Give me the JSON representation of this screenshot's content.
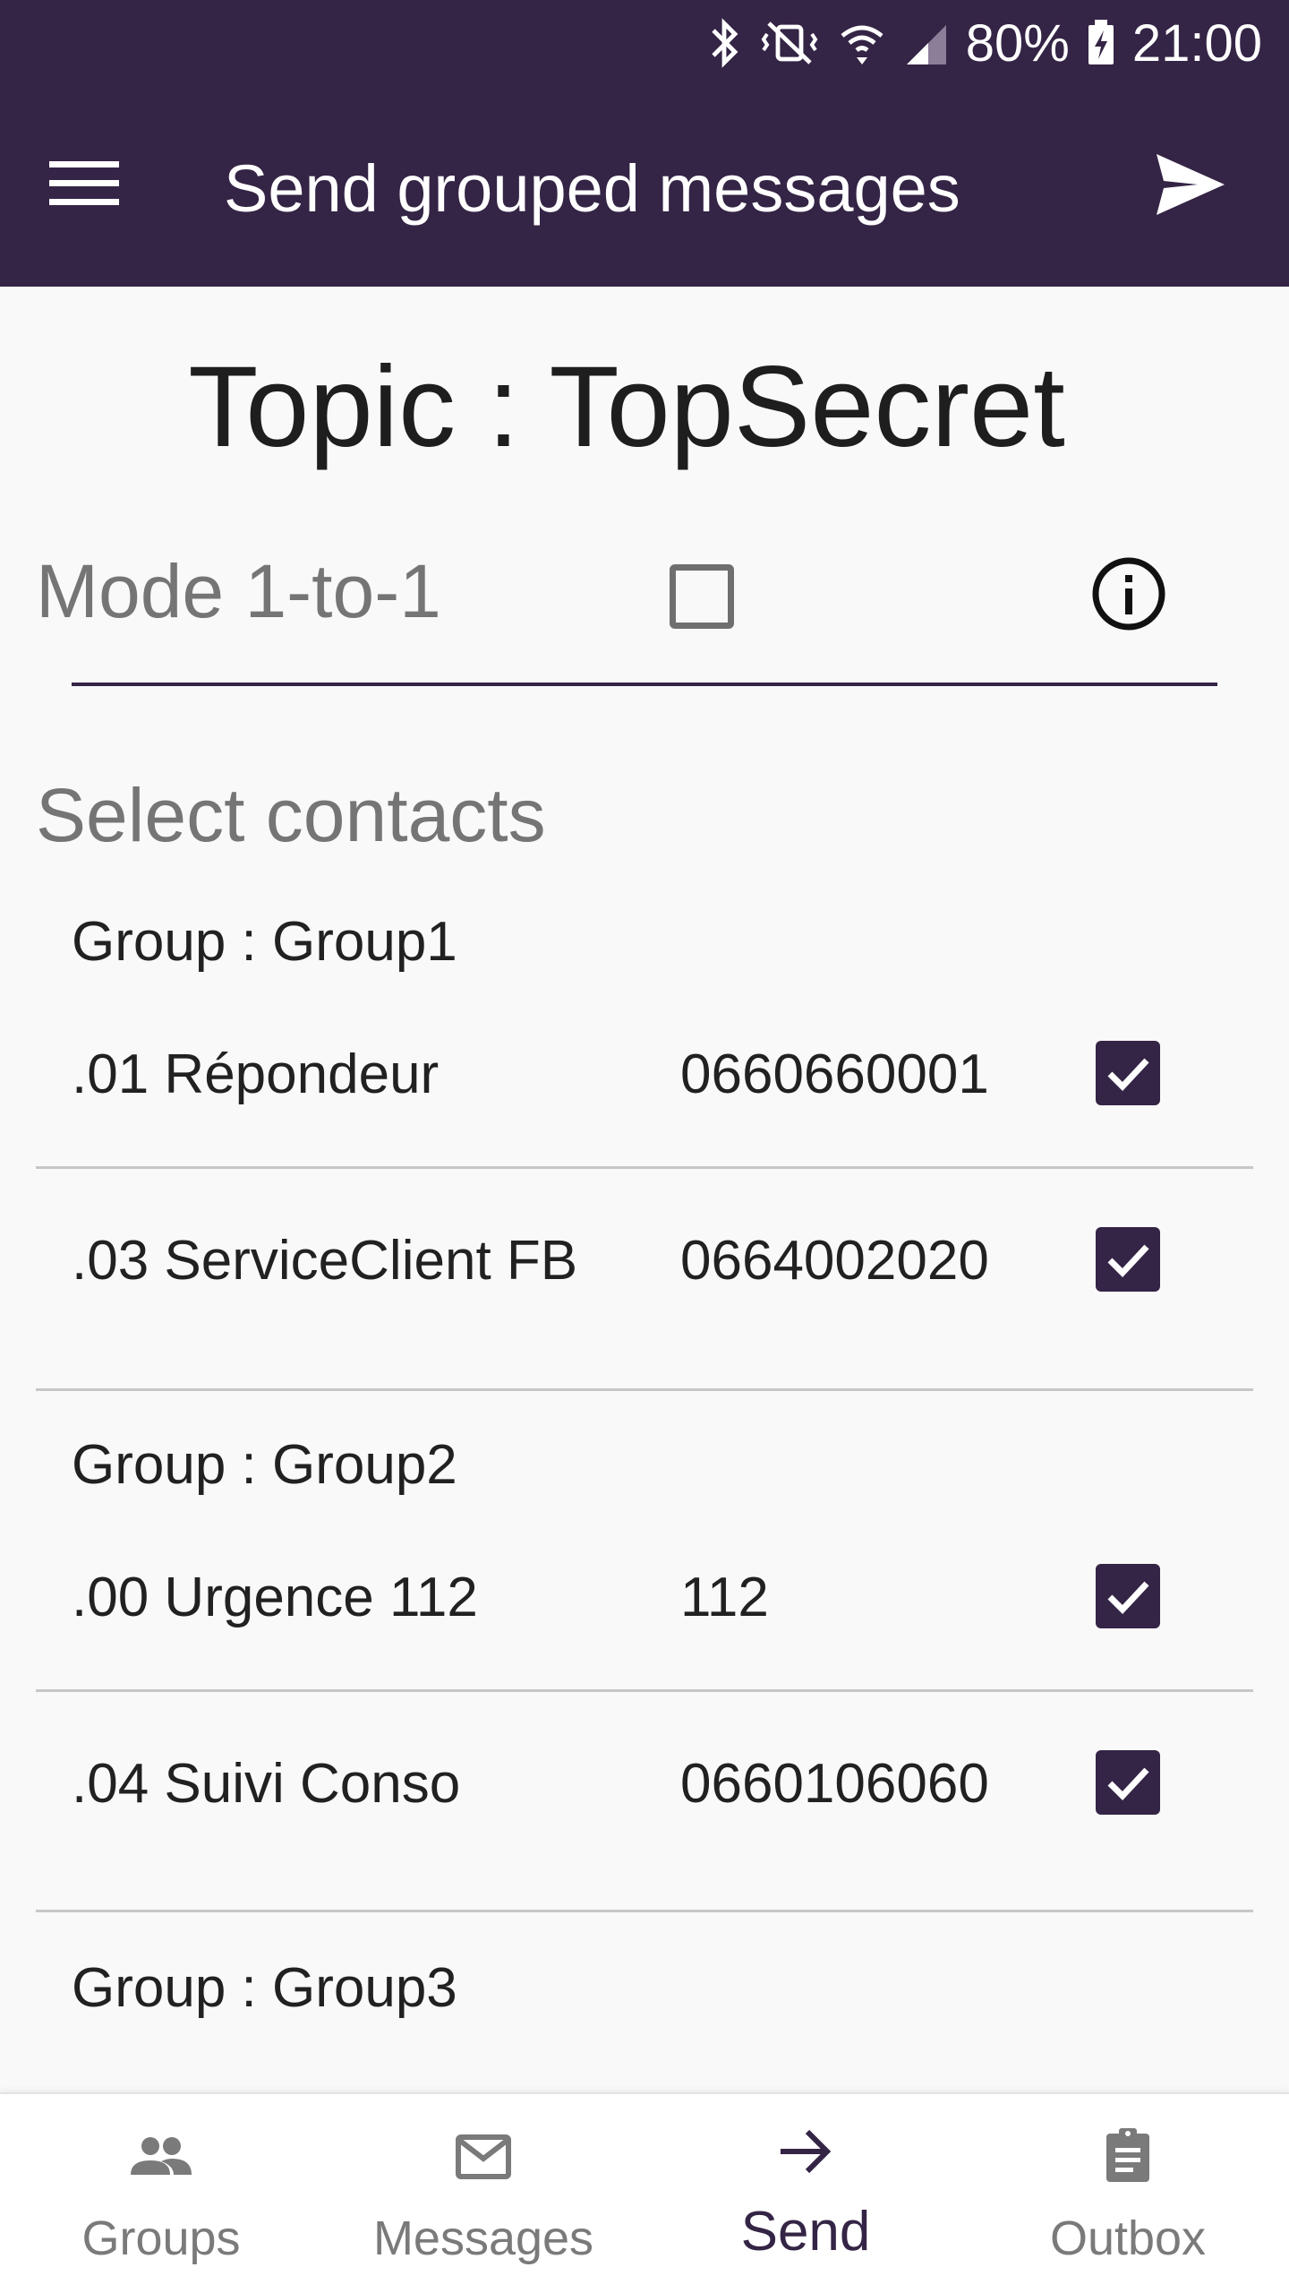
{
  "status_bar": {
    "battery": "80%",
    "time": "21:00",
    "icons": [
      "bluetooth-icon",
      "vibrate-icon",
      "wifi-icon",
      "signal-icon",
      "battery-charging-icon"
    ]
  },
  "app_bar": {
    "title": "Send grouped messages",
    "menu_icon": "hamburger-menu-icon",
    "send_icon": "send-icon"
  },
  "topic": {
    "title": "Topic : TopSecret"
  },
  "mode": {
    "label": "Mode 1-to-1",
    "checked": false,
    "info_icon": "info-icon"
  },
  "contacts": {
    "section_title": "Select contacts",
    "groups": [
      {
        "header": "Group : Group1",
        "items": [
          {
            "name": ".01 Répondeur",
            "number": "0660660001",
            "checked": true
          },
          {
            "name": ".03 ServiceClient FB",
            "number": "0664002020",
            "checked": true
          }
        ]
      },
      {
        "header": "Group : Group2",
        "items": [
          {
            "name": ".00 Urgence 112",
            "number": "112",
            "checked": true
          },
          {
            "name": ".04 Suivi Conso",
            "number": "0660106060",
            "checked": true
          }
        ]
      },
      {
        "header": "Group : Group3",
        "items": []
      }
    ]
  },
  "bottom_nav": {
    "items": [
      {
        "label": "Groups",
        "icon": "groups-icon",
        "active": false
      },
      {
        "label": "Messages",
        "icon": "mail-icon",
        "active": false
      },
      {
        "label": "Send",
        "icon": "arrow-right-icon",
        "active": true
      },
      {
        "label": "Outbox",
        "icon": "clipboard-icon",
        "active": false
      }
    ]
  },
  "colors": {
    "primary": "#342445",
    "background": "#f9f9f9",
    "muted_text": "#757575",
    "divider": "#c7c7c7"
  }
}
